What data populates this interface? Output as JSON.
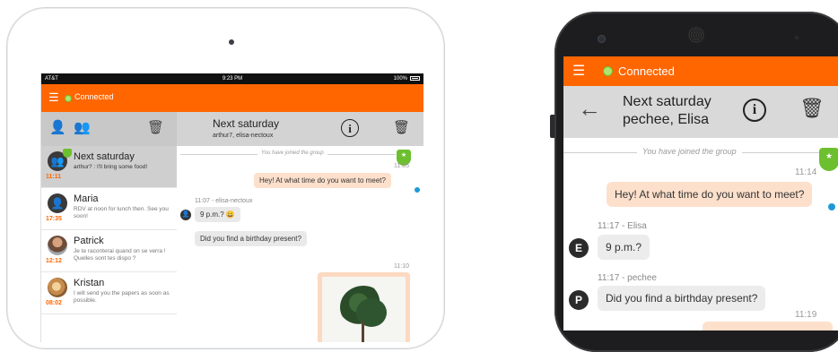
{
  "tablet": {
    "status": {
      "carrier": "AT&T",
      "time": "9:23 PM",
      "battery": "100%"
    },
    "topbar": {
      "status_text": "Connected"
    },
    "chat_header": {
      "title": "Next saturday",
      "members": "arthur7, elisa-nectoux"
    },
    "conversations": [
      {
        "name": "Next saturday",
        "snippet": "arthur? : I'll bring some food!",
        "time": "11:11",
        "avatar": "group-icon"
      },
      {
        "name": "Maria",
        "snippet": "RDV at noon for lunch then. See you soon!",
        "time": "17:35",
        "avatar": "person-icon"
      },
      {
        "name": "Patrick",
        "snippet": "Je te raconterai quand on se verra ! Quelles sont tes dispo ?",
        "time": "12:12",
        "avatar": "photo"
      },
      {
        "name": "Kristan",
        "snippet": "I will send you the papers as soon as possible.",
        "time": "08:02",
        "avatar": "photo"
      }
    ],
    "messages": {
      "joined": "You have joined the group",
      "t1": "11:05",
      "m1": "Hey! At what time do you want to meet?",
      "meta2": "11:07 - elisa-nectoux",
      "m2": "9 p.m.? 😀",
      "m3": "Did you find a birthday present?",
      "t4": "11:10"
    }
  },
  "phone": {
    "topbar": {
      "status_text": "Connected"
    },
    "chat_header": {
      "title_line1": "Next saturday",
      "title_line2": "pechee, Elisa"
    },
    "messages": {
      "joined": "You have joined the group",
      "t1": "11:14",
      "m1": "Hey! At what time do you want to meet?",
      "meta2": "11:17 - Elisa",
      "avatar2": "E",
      "m2": "9 p.m.?",
      "meta3": "11:17 - pechee",
      "avatar3": "P",
      "m3": "Did you find a birthday present?",
      "t4": "11:19"
    }
  },
  "colors": {
    "accent": "#ff6600",
    "connected": "#aee571",
    "outgoing_bubble": "#fde0cc",
    "incoming_bubble": "#ececec",
    "read_check": "#1e9ad6",
    "shield": "#6cbf2e"
  }
}
